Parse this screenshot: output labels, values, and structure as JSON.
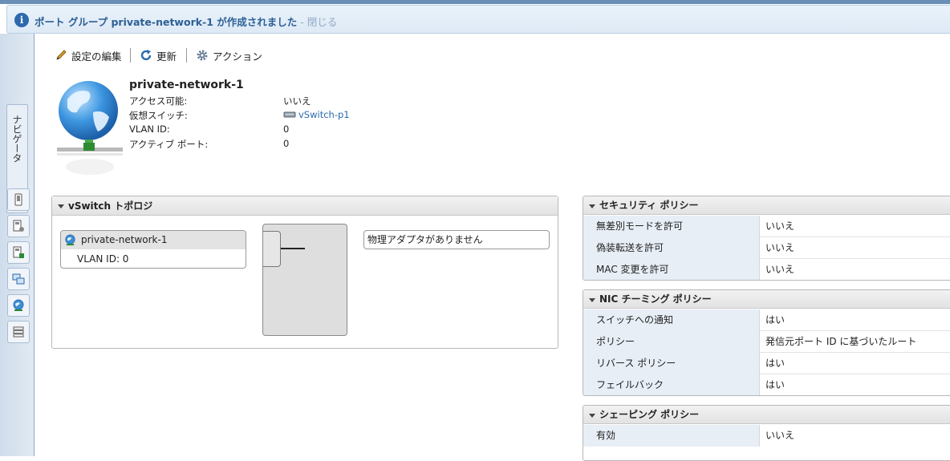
{
  "notification": {
    "message": "ポート グループ private-network-1 が作成されました",
    "separator": " - ",
    "close_label": "閉じる"
  },
  "sidebar": {
    "navigator_label": "ナビゲータ"
  },
  "toolbar": {
    "edit_label": "設定の編集",
    "refresh_label": "更新",
    "actions_label": "アクション"
  },
  "summary": {
    "title": "private-network-1",
    "properties": [
      {
        "key": "アクセス可能:",
        "value": "いいえ"
      },
      {
        "key": "仮想スイッチ:",
        "value": "vSwitch-p1"
      },
      {
        "key": "VLAN ID:",
        "value": "0"
      },
      {
        "key": "アクティブ ポート:",
        "value": "0"
      }
    ]
  },
  "topology": {
    "title": "vSwitch トポロジ",
    "portgroup_name": "private-network-1",
    "portgroup_vlan": "VLAN ID: 0",
    "adapter_text": "物理アダプタがありません"
  },
  "security_policy": {
    "title": "セキュリティ ポリシー",
    "rows": [
      {
        "key": "無差別モードを許可",
        "value": "いいえ"
      },
      {
        "key": "偽装転送を許可",
        "value": "いいえ"
      },
      {
        "key": "MAC 変更を許可",
        "value": "いいえ"
      }
    ]
  },
  "nic_teaming_policy": {
    "title": "NIC チーミング ポリシー",
    "rows": [
      {
        "key": "スイッチへの通知",
        "value": "はい"
      },
      {
        "key": "ポリシー",
        "value": "発信元ポート ID に基づいたルート"
      },
      {
        "key": "リバース ポリシー",
        "value": "はい"
      },
      {
        "key": "フェイルバック",
        "value": "はい"
      }
    ]
  },
  "shaping_policy": {
    "title": "シェーピング ポリシー",
    "rows": [
      {
        "key": "有効",
        "value": "いいえ"
      }
    ]
  },
  "colors": {
    "accent": "#2c69ad",
    "header_row_bg": "#e7eef6"
  }
}
